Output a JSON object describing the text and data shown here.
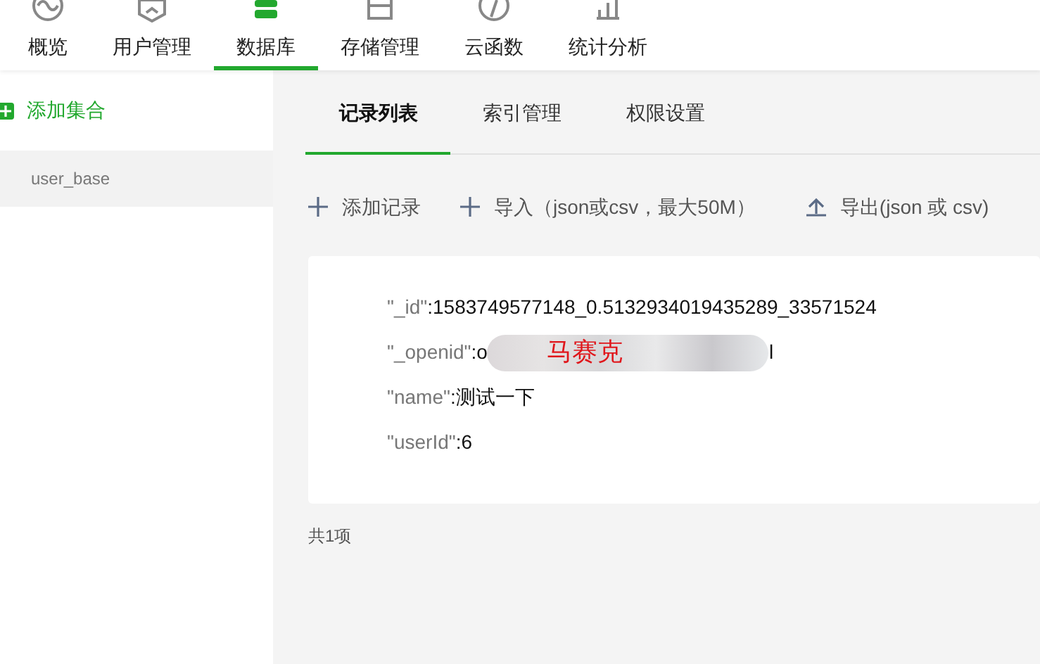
{
  "nav_tabs": [
    {
      "label": "概览",
      "selected": false
    },
    {
      "label": "用户管理",
      "selected": false
    },
    {
      "label": "数据库",
      "selected": true
    },
    {
      "label": "存储管理",
      "selected": false
    },
    {
      "label": "云函数",
      "selected": false
    },
    {
      "label": "统计分析",
      "selected": false
    }
  ],
  "sidebar": {
    "add_button": "添加集合",
    "items": [
      {
        "label": "user_base",
        "selected": true
      }
    ]
  },
  "tabs": [
    {
      "label": "记录列表",
      "selected": true
    },
    {
      "label": "索引管理",
      "selected": false
    },
    {
      "label": "权限设置",
      "selected": false
    }
  ],
  "actions": [
    {
      "label": "添加记录"
    },
    {
      "label": "导入（json或csv，最大50M）"
    },
    {
      "label": "导出(json 或 csv)"
    }
  ],
  "record": [
    {
      "key": "\"_id\"",
      "sep": ":",
      "value": "1583749577148_0.5132934019435289_33571524"
    },
    {
      "key": "\"_openid\"",
      "sep": ":",
      "value": "o",
      "redaction": "马赛克",
      "tail": "l"
    },
    {
      "key": "\"name\"",
      "sep": ":",
      "value": "测试一下"
    },
    {
      "key": "\"userId\"",
      "sep": ":",
      "value": "6"
    }
  ],
  "count": "共1项"
}
